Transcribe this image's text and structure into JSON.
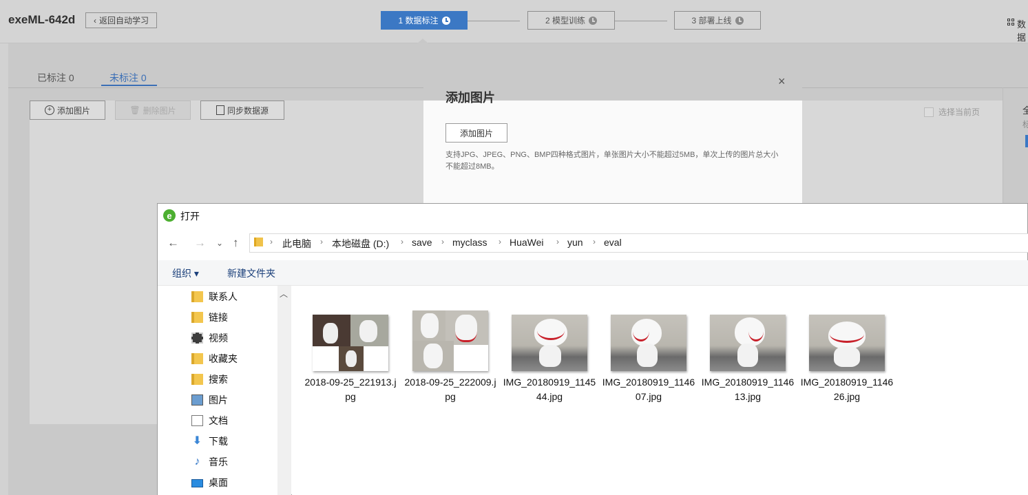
{
  "header": {
    "app_title": "exeML-642d",
    "back_label": "返回自动学习",
    "steps": [
      {
        "label": "1 数据标注",
        "active": true
      },
      {
        "label": "2 模型训练",
        "active": false
      },
      {
        "label": "3 部署上线",
        "active": false
      }
    ],
    "data_label": "数据"
  },
  "tabs": [
    {
      "label": "已标注 0"
    },
    {
      "label": "未标注 0"
    }
  ],
  "toolbar": {
    "add_label": "添加图片",
    "delete_label": "删除图片",
    "sync_label": "同步数据源",
    "select_page_label": "选择当前页"
  },
  "right_panel": {
    "text1": "全",
    "text2": "标"
  },
  "modal": {
    "title": "添加图片",
    "add_button": "添加图片",
    "hint": "支持JPG、JPEG、PNG、BMP四种格式图片，单张图片大小不能超过5MB，单次上传的图片总大小不能超过8MB。",
    "close_icon": "×"
  },
  "dialog": {
    "title": "打开",
    "breadcrumbs": [
      "此电脑",
      "本地磁盘 (D:)",
      "save",
      "myclass",
      "HuaWei",
      "yun",
      "eval"
    ],
    "organize_label": "组织 ▾",
    "new_folder_label": "新建文件夹",
    "nav_items": [
      {
        "label": "联系人",
        "icon": "contacts-icon"
      },
      {
        "label": "链接",
        "icon": "links-icon"
      },
      {
        "label": "视频",
        "icon": "video-icon"
      },
      {
        "label": "收藏夹",
        "icon": "favorites-icon"
      },
      {
        "label": "搜索",
        "icon": "search-icon"
      },
      {
        "label": "图片",
        "icon": "pictures-icon"
      },
      {
        "label": "文档",
        "icon": "documents-icon"
      },
      {
        "label": "下载",
        "icon": "download-icon"
      },
      {
        "label": "音乐",
        "icon": "music-icon"
      },
      {
        "label": "桌面",
        "icon": "desktop-icon"
      }
    ],
    "files": [
      {
        "name": "2018-09-25_221913.jpg",
        "kind": "collage"
      },
      {
        "name": "2018-09-25_222009.jpg",
        "kind": "collage"
      },
      {
        "name": "IMG_20180919_114544.jpg",
        "kind": "photo"
      },
      {
        "name": "IMG_20180919_114607.jpg",
        "kind": "photo"
      },
      {
        "name": "IMG_20180919_114613.jpg",
        "kind": "photo"
      },
      {
        "name": "IMG_20180919_114626.jpg",
        "kind": "photo"
      }
    ]
  },
  "colors": {
    "accent": "#3b78c4",
    "overlay": "#c9c9c9"
  }
}
